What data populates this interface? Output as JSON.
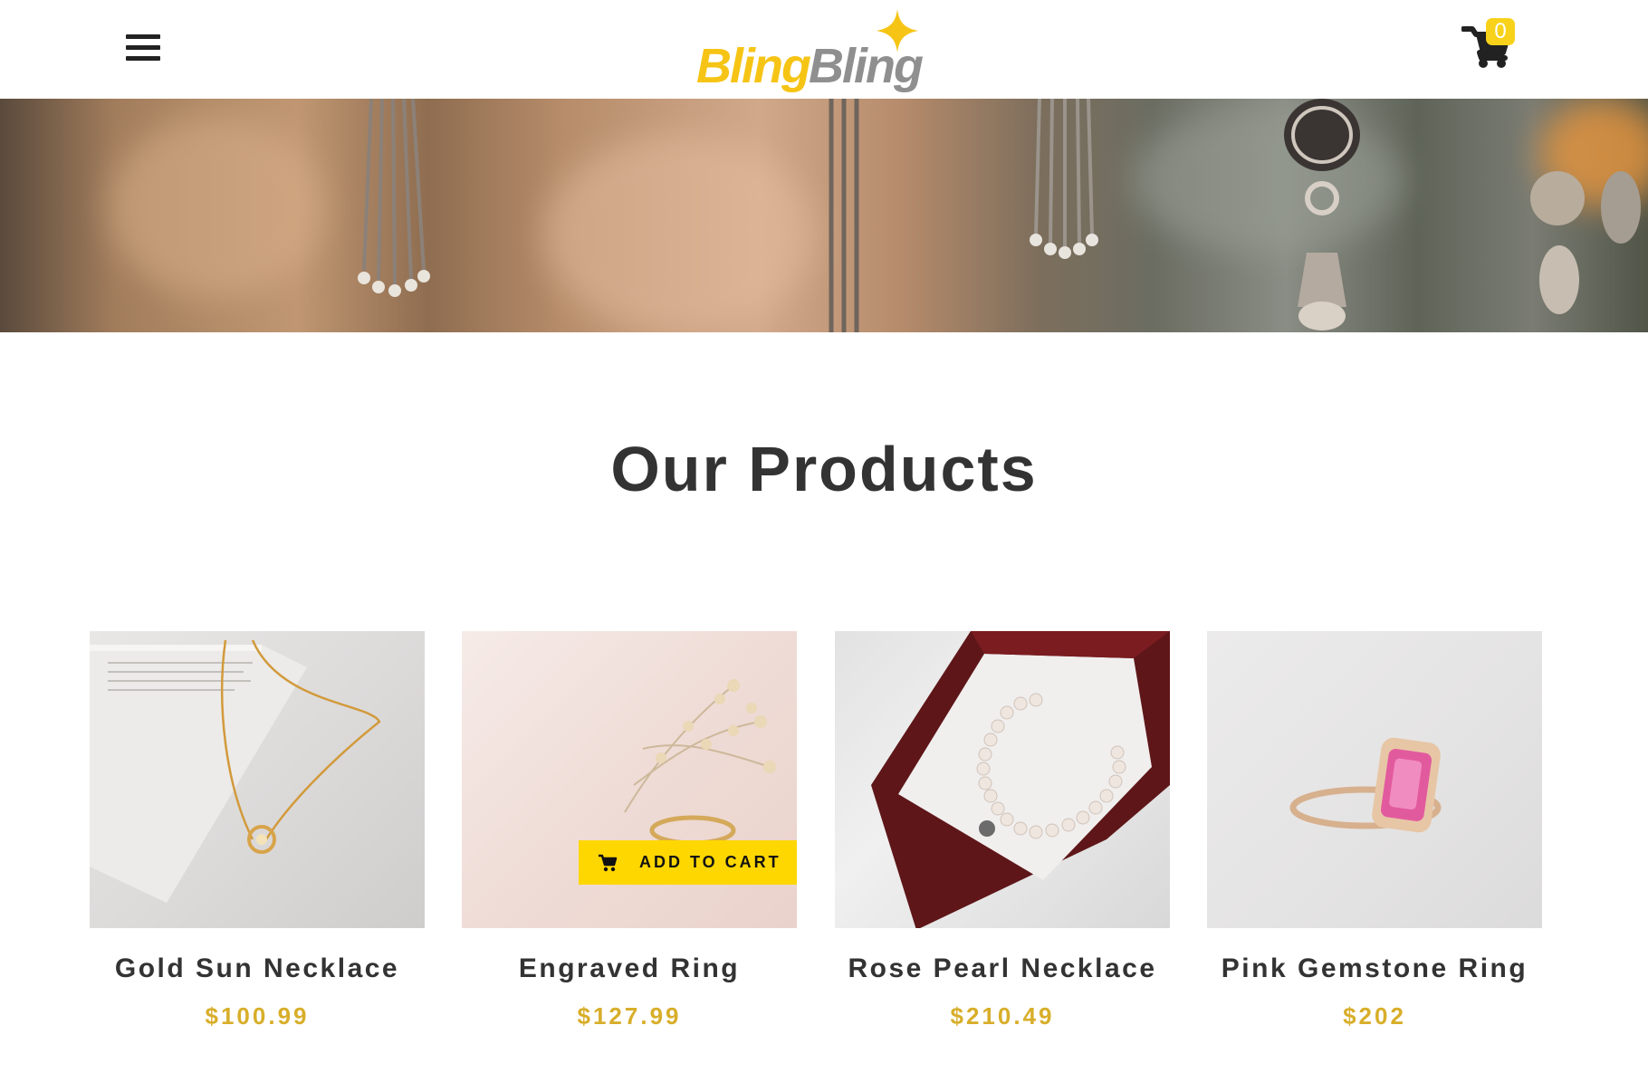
{
  "header": {
    "logo": {
      "word1": "Bling",
      "word2": "Bling"
    },
    "cart_count": "0",
    "menu_icon": "hamburger-icon",
    "cart_icon": "shopping-cart-icon"
  },
  "colors": {
    "accent_yellow": "#fed700",
    "price_gold": "#d8ae2a",
    "title_text": "#333333",
    "logo_gray": "#8f8f8f"
  },
  "section": {
    "title": "Our Products"
  },
  "products": [
    {
      "name": "Gold Sun Necklace",
      "price": "$100.99"
    },
    {
      "name": "Engraved Ring",
      "price": "$127.99",
      "add_to_cart": "ADD TO CART"
    },
    {
      "name": "Rose Pearl Necklace",
      "price": "$210.49"
    },
    {
      "name": "Pink Gemstone Ring",
      "price": "$202"
    }
  ]
}
